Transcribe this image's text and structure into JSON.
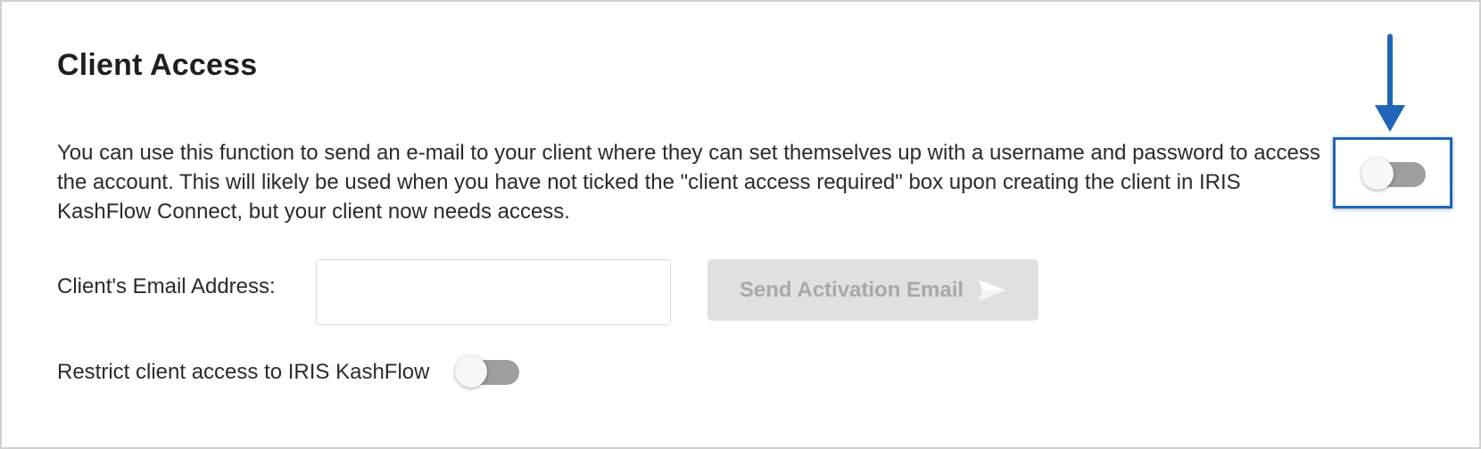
{
  "section": {
    "title": "Client Access",
    "description": "You can use this function to send an e-mail to your client where they can set themselves up with a username and password to access the account. This will likely be used when you have not ticked the \"client access required\" box upon creating the client in IRIS KashFlow Connect, but your client now needs access."
  },
  "client_access_toggle": {
    "state": "off"
  },
  "email": {
    "label": "Client's Email Address:",
    "value": "",
    "placeholder": ""
  },
  "send_button": {
    "label": "Send Activation Email",
    "icon": "send-icon",
    "state": "disabled"
  },
  "restrict": {
    "label": "Restrict client access to IRIS KashFlow",
    "state": "off"
  },
  "annotation": {
    "arrow_color": "#1f66b8",
    "box_color": "#1f66b8",
    "target": "client_access_toggle"
  },
  "colors": {
    "toggle_off_track": "#9e9e9e",
    "button_disabled_bg": "#e0e0e0",
    "button_disabled_text": "#a8a8a8"
  }
}
